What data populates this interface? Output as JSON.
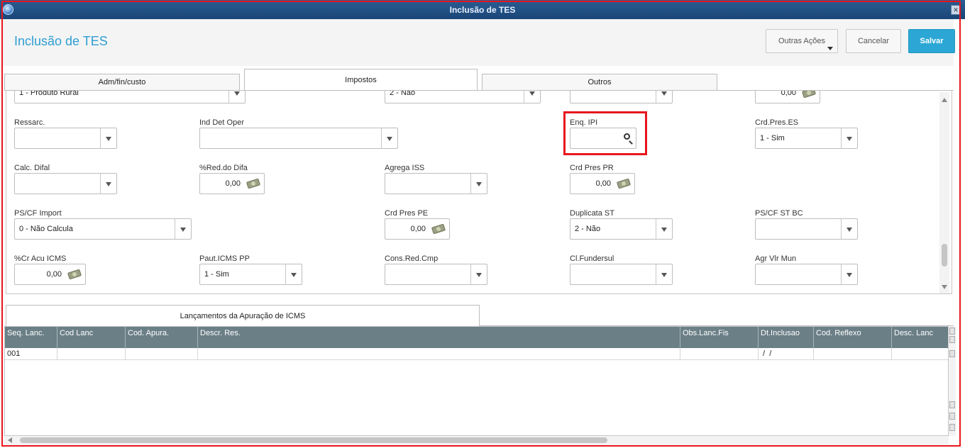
{
  "window": {
    "title": "Inclusão de TES"
  },
  "header": {
    "page_title": "Inclusão de TES",
    "buttons": {
      "outras_acoes": "Outras Ações",
      "cancelar": "Cancelar",
      "salvar": "Salvar"
    }
  },
  "tabs": [
    {
      "label": "Adm/fin/custo",
      "active": false
    },
    {
      "label": "Impostos",
      "active": true
    },
    {
      "label": "Outros",
      "active": false
    }
  ],
  "form": {
    "partial_row": {
      "f1_value": "1 - Produto Rural",
      "f2_value": "2 - Não",
      "f3_value": "",
      "f4_value": "0,00"
    },
    "ressarc": {
      "label": "Ressarc.",
      "value": ""
    },
    "ind_det_oper": {
      "label": "Ind Det Oper",
      "value": ""
    },
    "enq_ipi": {
      "label": "Enq. IPI",
      "value": ""
    },
    "crd_pres_es": {
      "label": "Crd.Pres.ES",
      "value": "1 - Sim"
    },
    "calc_difal": {
      "label": "Calc. Difal",
      "value": ""
    },
    "red_difa": {
      "label": "%Red.do Difa",
      "value": "0,00"
    },
    "agrega_iss": {
      "label": "Agrega ISS",
      "value": ""
    },
    "crd_pres_pr": {
      "label": "Crd Pres PR",
      "value": "0,00"
    },
    "pscf_import": {
      "label": "PS/CF Import",
      "value": "0 - Não Calcula"
    },
    "crd_pres_pe": {
      "label": "Crd Pres PE",
      "value": "0,00"
    },
    "duplicata_st": {
      "label": "Duplicata ST",
      "value": "2 - Não"
    },
    "pscf_st_bc": {
      "label": "PS/CF ST BC",
      "value": ""
    },
    "cr_acu_icms": {
      "label": "%Cr Acu ICMS",
      "value": "0,00"
    },
    "paut_icms_pp": {
      "label": "Paut.ICMS PP",
      "value": "1 - Sim"
    },
    "cons_red_cmp": {
      "label": "Cons.Red.Cmp",
      "value": ""
    },
    "cl_fundersul": {
      "label": "Cl.Fundersul",
      "value": ""
    },
    "agr_vlr_mun": {
      "label": "Agr Vlr Mun",
      "value": ""
    }
  },
  "apuracao": {
    "tab_label": "Lançamentos da Apuração de ICMS",
    "columns": [
      "Seq. Lanc.",
      "Cod Lanc",
      "Cod. Apura.",
      "Descr. Res.",
      "Obs.Lanc.Fis",
      "Dt.Inclusao",
      "Cod. Reflexo",
      "Desc. Lanc"
    ],
    "rows": [
      [
        "001",
        "",
        "",
        "",
        "",
        " /  /",
        "",
        ""
      ]
    ]
  },
  "icons": [
    "app-globe-icon",
    "close-icon",
    "chevron-down-icon",
    "money-icon",
    "search-icon"
  ]
}
